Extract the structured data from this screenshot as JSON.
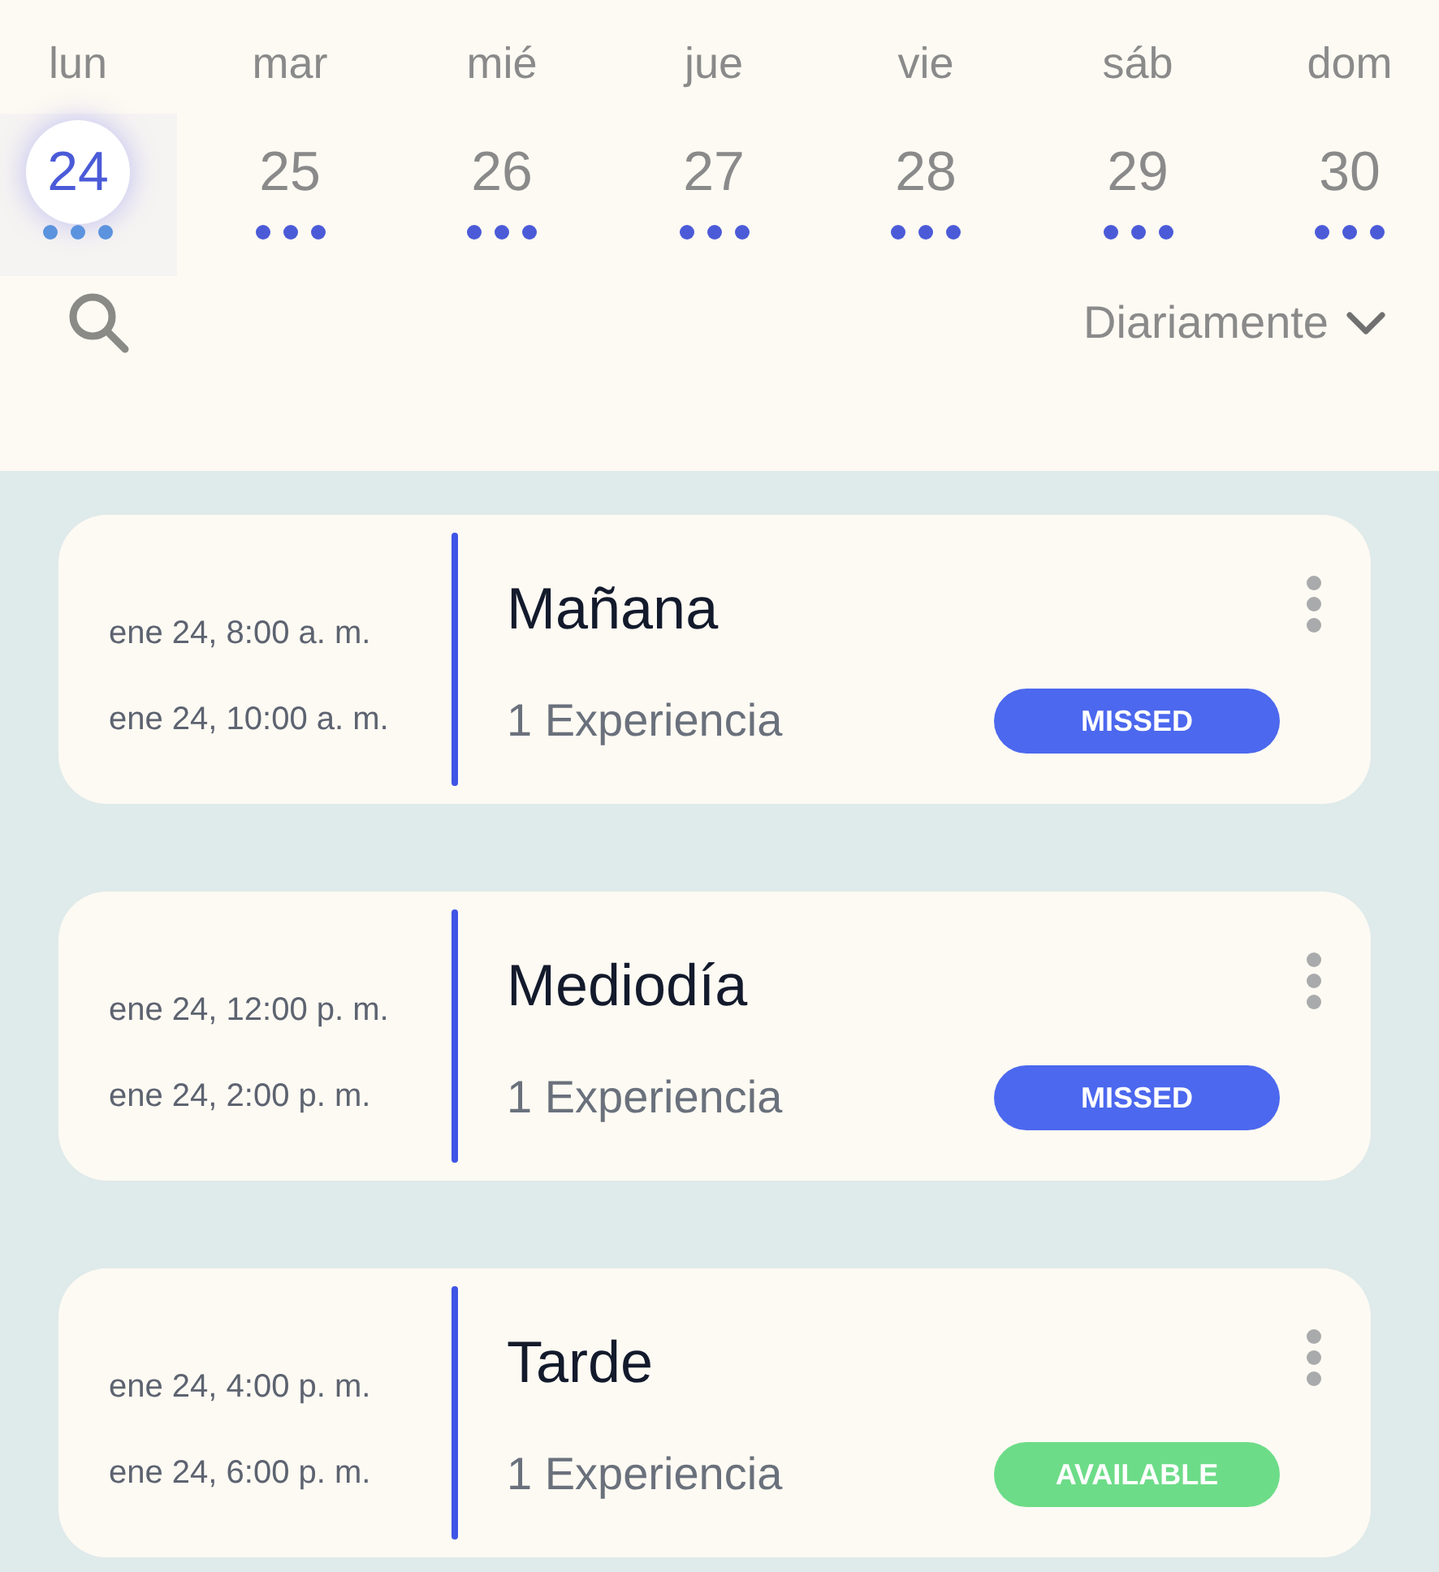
{
  "week": [
    {
      "weekday": "lun",
      "day": "24",
      "selected": true
    },
    {
      "weekday": "mar",
      "day": "25",
      "selected": false
    },
    {
      "weekday": "mié",
      "day": "26",
      "selected": false
    },
    {
      "weekday": "jue",
      "day": "27",
      "selected": false
    },
    {
      "weekday": "vie",
      "day": "28",
      "selected": false
    },
    {
      "weekday": "sáb",
      "day": "29",
      "selected": false
    },
    {
      "weekday": "dom",
      "day": "30",
      "selected": false
    }
  ],
  "filter": {
    "value": "Diariamente"
  },
  "sessions": [
    {
      "start": "ene 24, 8:00 a. m.",
      "end": "ene 24, 10:00 a. m.",
      "title": "Mañana",
      "count": "1 Experiencia",
      "status": "MISSED",
      "kind": "missed"
    },
    {
      "start": "ene 24, 12:00 p. m.",
      "end": "ene 24, 2:00 p. m.",
      "title": "Mediodía",
      "count": "1 Experiencia",
      "status": "MISSED",
      "kind": "missed"
    },
    {
      "start": "ene 24, 4:00 p. m.",
      "end": "ene 24, 6:00 p. m.",
      "title": "Tarde",
      "count": "1 Experiencia",
      "status": "AVAILABLE",
      "kind": "available"
    }
  ]
}
